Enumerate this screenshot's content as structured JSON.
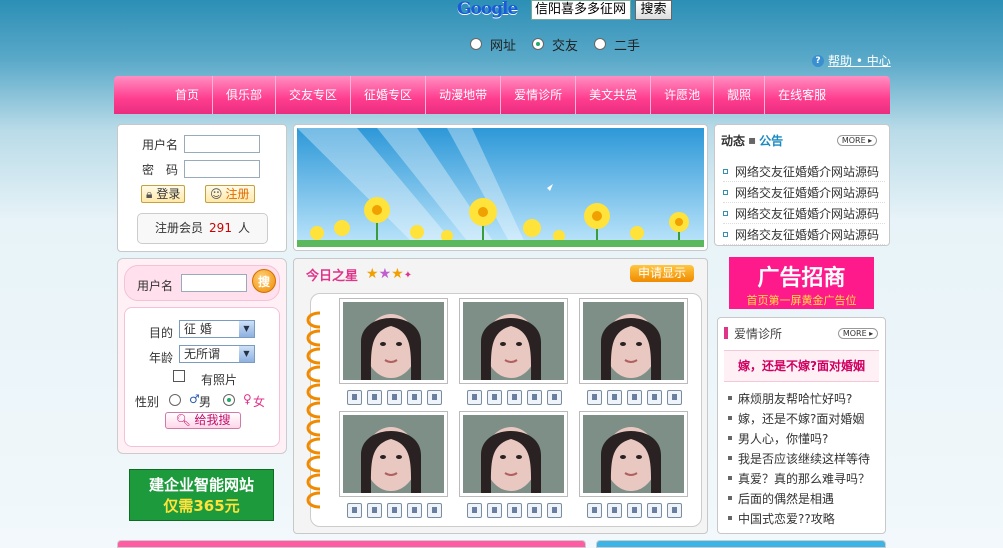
{
  "search": {
    "logo": "Google",
    "query": "信阳喜多多征网",
    "button": "搜索",
    "options": [
      "网址",
      "交友",
      "二手"
    ],
    "selected_option": "交友"
  },
  "help": {
    "text": "帮助 • 中心"
  },
  "nav": {
    "items": [
      "首页",
      "俱乐部",
      "交友专区",
      "征婚专区",
      "动漫地带",
      "爱情诊所",
      "美文共赏",
      "许愿池",
      "靓照",
      "在线客服"
    ]
  },
  "login": {
    "username_label": "用户名",
    "password_label": "密　码",
    "login_button": "登录",
    "register_button": "注册",
    "member_prefix": "注册会员",
    "member_count": "291",
    "member_suffix": "人"
  },
  "notice": {
    "title_a": "动态",
    "title_b": "公告",
    "more": "MORE",
    "items": [
      "网络交友征婚婚介网站源码",
      "网络交友征婚婚介网站源码",
      "网络交友征婚婚介网站源码",
      "网络交友征婚婚介网站源码"
    ]
  },
  "quick_search": {
    "username_label": "用户名",
    "go_button": "搜",
    "purpose_label": "目的",
    "purpose_value": "征 婚",
    "age_label": "年龄",
    "age_value": "无所谓",
    "photo_label": "有照片",
    "gender_label": "性别",
    "male_label": "男",
    "female_label": "女",
    "gender_selected": "女",
    "search_button": "给我搜"
  },
  "ad_left": {
    "line1": "建企业智能网站",
    "line2": "仅需365元"
  },
  "star": {
    "title": "今日之星",
    "apply_button": "申请显示",
    "photo_count": 6
  },
  "ad_right": {
    "line1": "广告招商",
    "line2": "首页第一屏黄金广告位"
  },
  "love": {
    "title": "爱情诊所",
    "more": "MORE",
    "headline": "嫁，还是不嫁?面对婚姻",
    "items": [
      "麻烦朋友帮哈忙好吗?",
      "嫁，还是不嫁?面对婚姻",
      "男人心，你懂吗?",
      "我是否应该继续这样等待",
      "真爱？真的那么难寻吗？",
      "后面的偶然是相遇",
      "中国式恋爱??攻略"
    ]
  },
  "colors": {
    "nav_pink": "#ff3d8f",
    "accent_green": "#1c9a3c",
    "ad_pink": "#ff1a8c"
  }
}
